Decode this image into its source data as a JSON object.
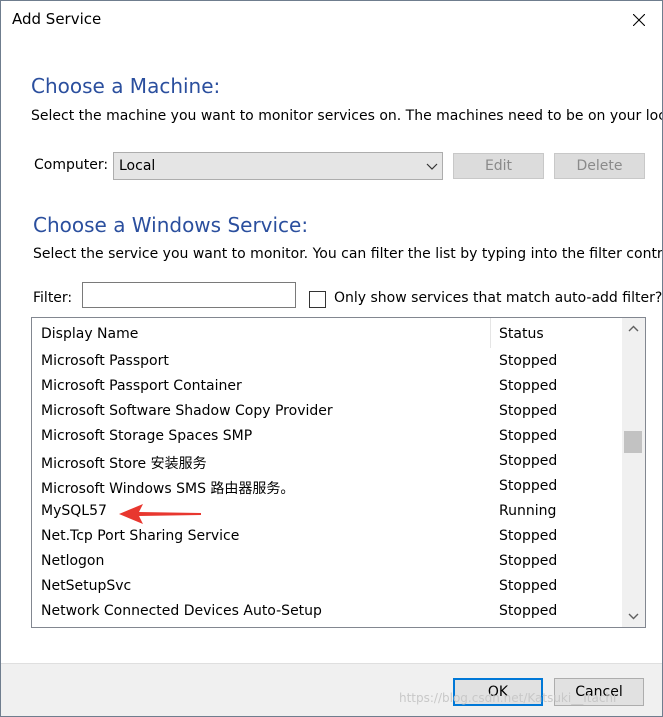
{
  "window": {
    "title": "Add Service"
  },
  "machine_section": {
    "heading": "Choose a Machine:",
    "description": "Select the machine you want to monitor services on. The machines need to be on your local",
    "computer_label": "Computer:",
    "computer_value": "Local",
    "edit_label": "Edit",
    "delete_label": "Delete"
  },
  "service_section": {
    "heading": "Choose a Windows Service:",
    "description": "Select the service you want to monitor. You can filter the list by typing into the filter control.",
    "filter_label": "Filter:",
    "filter_value": "",
    "checkbox_label": "Only show services that match auto-add filter?",
    "checkbox_checked": false
  },
  "services_table": {
    "columns": [
      "Display Name",
      "Status"
    ],
    "rows": [
      {
        "name": "Microsoft Passport",
        "status": "Stopped"
      },
      {
        "name": "Microsoft Passport Container",
        "status": "Stopped"
      },
      {
        "name": "Microsoft Software Shadow Copy Provider",
        "status": "Stopped"
      },
      {
        "name": "Microsoft Storage Spaces SMP",
        "status": "Stopped"
      },
      {
        "name": "Microsoft Store 安装服务",
        "status": "Stopped"
      },
      {
        "name": "Microsoft Windows SMS 路由器服务。",
        "status": "Stopped"
      },
      {
        "name": "MySQL57",
        "status": "Running"
      },
      {
        "name": "Net.Tcp Port Sharing Service",
        "status": "Stopped"
      },
      {
        "name": "Netlogon",
        "status": "Stopped"
      },
      {
        "name": "NetSetupSvc",
        "status": "Stopped"
      },
      {
        "name": "Network Connected Devices Auto-Setup",
        "status": "Stopped"
      }
    ]
  },
  "footer": {
    "ok_label": "OK",
    "cancel_label": "Cancel",
    "watermark": "https://blog.csdn.net/Katsuki__Itachi"
  },
  "colors": {
    "heading": "#2b4f9e",
    "default_button_border": "#0078d7",
    "annotation_arrow": "#e8372f"
  }
}
